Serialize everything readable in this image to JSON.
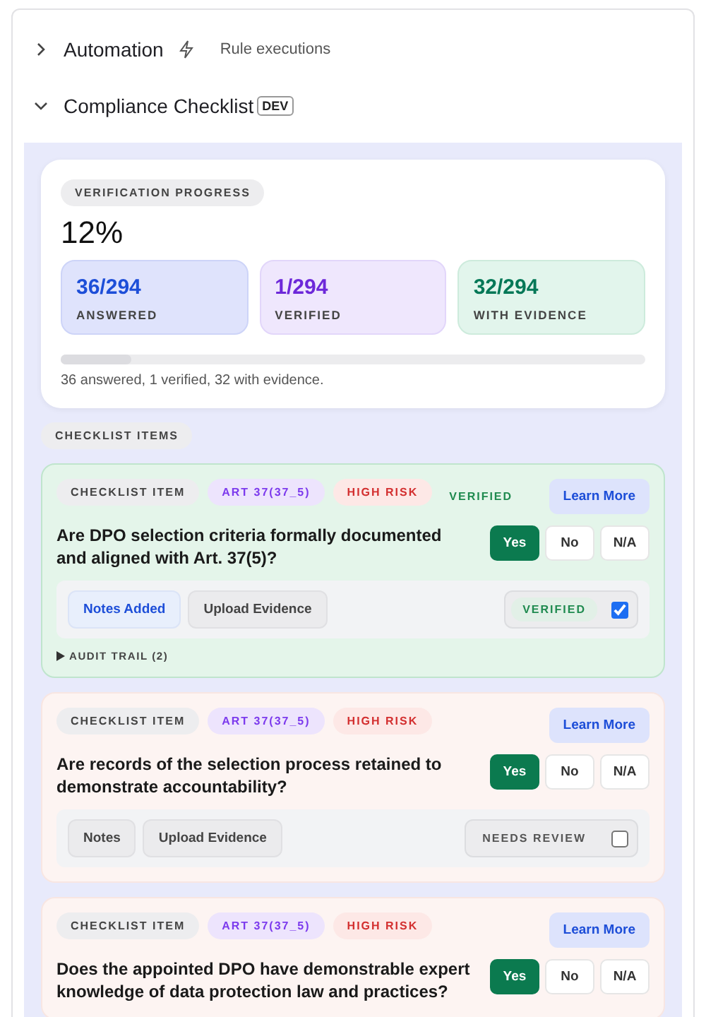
{
  "sections": [
    {
      "title": "Automation",
      "expanded": false,
      "subtitle": "Rule executions"
    },
    {
      "title": "Compliance Checklist",
      "expanded": true,
      "badge": "DEV"
    }
  ],
  "progress": {
    "label": "VERIFICATION PROGRESS",
    "percent": "12%",
    "level": 0.12,
    "summary": "36 answered, 1 verified, 32 with evidence.",
    "stats": [
      {
        "value": "36/294",
        "label": "ANSWERED",
        "color": "#1d4ed8"
      },
      {
        "value": "1/294",
        "label": "VERIFIED",
        "color": "#6d28d9"
      },
      {
        "value": "32/294",
        "label": "WITH EVIDENCE",
        "color": "#047857"
      }
    ]
  },
  "items_label": "CHECKLIST ITEMS",
  "items": [
    {
      "tag": "CHECKLIST ITEM",
      "article": "ART 37(37_5)",
      "risk": "HIGH RISK",
      "status_text": "VERIFIED",
      "learn": "Learn More",
      "question": "Are DPO selection criteria formally documented and aligned with Art. 37(5)?",
      "answers": [
        {
          "label": "Yes",
          "selected": true
        },
        {
          "label": "No",
          "selected": false
        },
        {
          "label": "N/A",
          "selected": false
        }
      ],
      "footer": {
        "notes": "Notes Added",
        "has_notes": true,
        "upload": "Upload Evidence",
        "review": "VERIFIED",
        "checked": true
      },
      "audit": "AUDIT TRAIL (2)"
    },
    {
      "tag": "CHECKLIST ITEM",
      "article": "ART 37(37_5)",
      "risk": "HIGH RISK",
      "learn": "Learn More",
      "question": "Are records of the selection process retained to demonstrate accountability?",
      "answers": [
        {
          "label": "Yes",
          "selected": true
        },
        {
          "label": "No",
          "selected": false
        },
        {
          "label": "N/A",
          "selected": false
        }
      ],
      "footer": {
        "notes": "Notes",
        "has_notes": false,
        "upload": "Upload Evidence",
        "review": "NEEDS REVIEW",
        "checked": false
      }
    },
    {
      "tag": "CHECKLIST ITEM",
      "article": "ART 37(37_5)",
      "risk": "HIGH RISK",
      "learn": "Learn More",
      "question": "Does the appointed DPO have demonstrable expert knowledge of data protection law and practices?",
      "answers": [
        {
          "label": "Yes",
          "selected": true
        },
        {
          "label": "No",
          "selected": false
        },
        {
          "label": "N/A",
          "selected": false
        }
      ]
    }
  ]
}
